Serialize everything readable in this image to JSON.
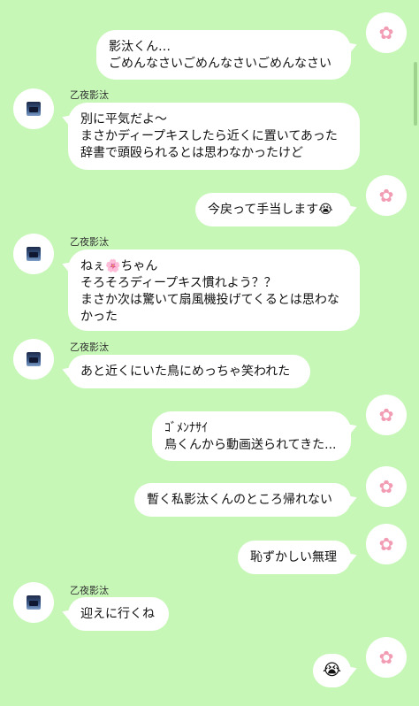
{
  "chat": {
    "contact_name": "乙夜影汰",
    "messages": [
      {
        "side": "right",
        "text": "影汰くん…\nごめんなさいごめんなさいごめんなさい"
      },
      {
        "side": "left",
        "name": "乙夜影汰",
        "text": "別に平気だよ〜\nまさかディープキスしたら近くに置いてあった辞書で頭殴られるとは思わなかったけど"
      },
      {
        "side": "right",
        "text": "今戻って手当します😭"
      },
      {
        "side": "left",
        "name": "乙夜影汰",
        "text": "ねぇ🌸ちゃん\nそろそろディープキス慣れよう？？\nまさか次は驚いて扇風機投げてくるとは思わなかった"
      },
      {
        "side": "left",
        "name": "乙夜影汰",
        "text": "あと近くにいた鳥にめっちゃ笑われた"
      },
      {
        "side": "right",
        "text": "ｺﾞﾒﾝﾅｻｲ\n鳥くんから動画送られてきた..."
      },
      {
        "side": "right",
        "text": "暫く私影汰くんのところ帰れない"
      },
      {
        "side": "right",
        "text": "恥ずかしい無理"
      },
      {
        "side": "left",
        "name": "乙夜影汰",
        "text": "迎えに行くね"
      },
      {
        "side": "right",
        "text": "😭"
      }
    ]
  },
  "icons": {
    "self_avatar": "cherry-blossom-icon",
    "contact_avatar": "night-city-icon"
  },
  "colors": {
    "background": "#c6f7b7",
    "bubble": "#ffffff",
    "avatar_flower": "#f29cb4"
  }
}
